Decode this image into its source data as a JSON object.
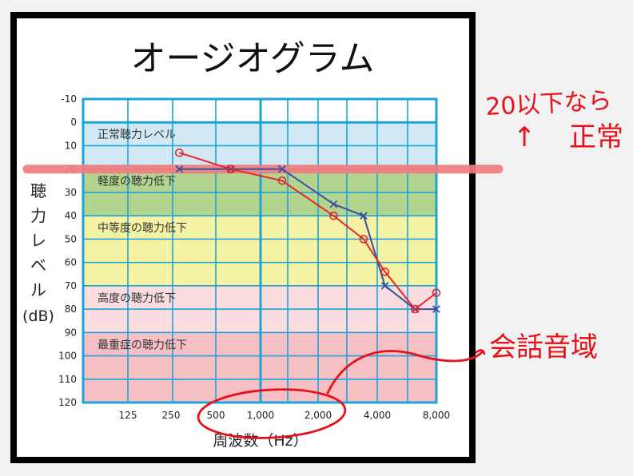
{
  "chart_data": {
    "type": "line",
    "title": "オージオグラム",
    "xlabel": "周波数（Hz）",
    "ylabel_chars": [
      "聴",
      "力",
      "レ",
      "ベ",
      "ル"
    ],
    "ylabel_unit": "(dB)",
    "x_tick_labels": [
      "125",
      "250",
      "500",
      "1,000",
      "2,000",
      "4,000",
      "8,000"
    ],
    "y_tick_labels": [
      "-10",
      "0",
      "10",
      "20",
      "30",
      "40",
      "50",
      "60",
      "70",
      "80",
      "90",
      "100",
      "110",
      "120"
    ],
    "ylim": [
      -10,
      120
    ],
    "y_inverted": true,
    "x_scale": "log2",
    "bands": [
      {
        "label": "正常聴力レベル",
        "from": 0,
        "to": 20,
        "color": "#d3e8f5"
      },
      {
        "label": "軽度の聴力低下",
        "from": 20,
        "to": 40,
        "color": "#b2d48f"
      },
      {
        "label": "中等度の聴力低下",
        "from": 40,
        "to": 70,
        "color": "#f6f2a3"
      },
      {
        "label": "高度の聴力低下",
        "from": 70,
        "to": 90,
        "color": "#fbdde0"
      },
      {
        "label": "最重症の聴力低下",
        "from": 90,
        "to": 120,
        "color": "#f6bfc4"
      }
    ],
    "series": [
      {
        "marker": "x",
        "color": "#3a4fa0",
        "points": [
          [
            250,
            20
          ],
          [
            500,
            20
          ],
          [
            1000,
            20
          ],
          [
            2000,
            35
          ],
          [
            3000,
            40
          ],
          [
            4000,
            70
          ],
          [
            6000,
            80
          ],
          [
            8000,
            80
          ]
        ]
      },
      {
        "marker": "o",
        "color": "#e8262b",
        "points": [
          [
            250,
            13
          ],
          [
            500,
            20
          ],
          [
            1000,
            25
          ],
          [
            2000,
            40
          ],
          [
            3000,
            50
          ],
          [
            4000,
            64
          ],
          [
            6000,
            80
          ],
          [
            8000,
            73
          ]
        ]
      }
    ],
    "grid": true
  },
  "annotations": {
    "threshold_note_top": "20以下なら",
    "threshold_note_arrow": "↑",
    "threshold_note_bottom": "正常",
    "threshold_value": 20,
    "speech_range_note": "会話音域",
    "speech_range_freqs": [
      500,
      2000
    ],
    "ink_color": "#e8101a",
    "highlight_color": "#f07d7f"
  }
}
